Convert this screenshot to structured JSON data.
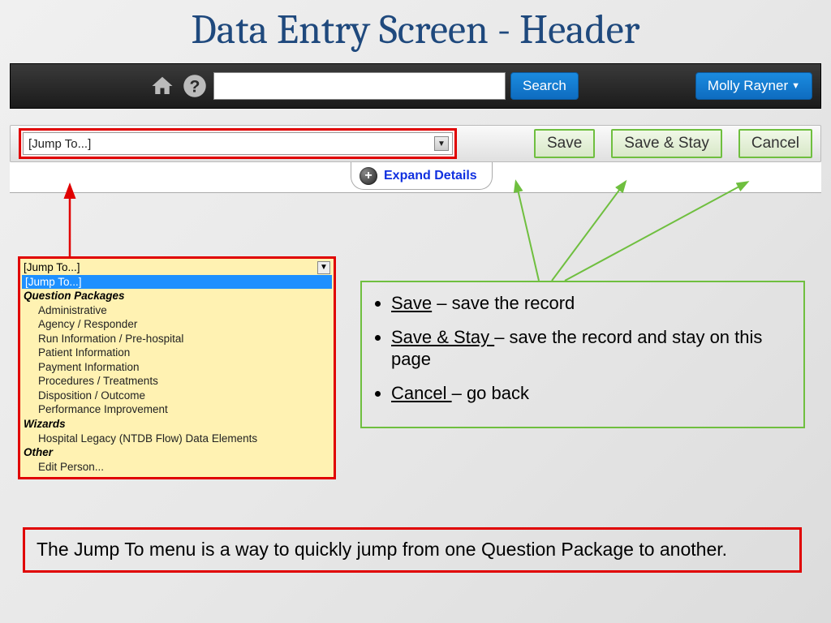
{
  "slide": {
    "title": "Data Entry Screen - Header"
  },
  "header": {
    "search_value": "",
    "search_button": "Search",
    "user_name": "Molly Rayner"
  },
  "actions": {
    "jump_placeholder": "[Jump To...]",
    "save": "Save",
    "save_stay": "Save & Stay",
    "cancel": "Cancel"
  },
  "expand": {
    "label": "Expand Details"
  },
  "dropdown": {
    "head": "[Jump To...]",
    "highlight": "[Jump To...]",
    "groups": [
      {
        "label": "Question Packages",
        "items": [
          "Administrative",
          "Agency / Responder",
          "Run Information / Pre-hospital",
          "Patient Information",
          "Payment Information",
          "Procedures / Treatments",
          "Disposition / Outcome",
          "Performance Improvement"
        ]
      },
      {
        "label": "Wizards",
        "items": [
          "Hospital Legacy (NTDB Flow) Data Elements"
        ]
      },
      {
        "label": "Other",
        "items": [
          "Edit Person..."
        ]
      }
    ]
  },
  "info": {
    "save_term": "Save",
    "save_desc": " – save the record",
    "stay_term": "Save & Stay ",
    "stay_desc": "– save the record and stay on this page",
    "cancel_term": "Cancel ",
    "cancel_desc": "– go back"
  },
  "footnote": "The Jump To menu is a way to quickly jump from one Question Package to another."
}
